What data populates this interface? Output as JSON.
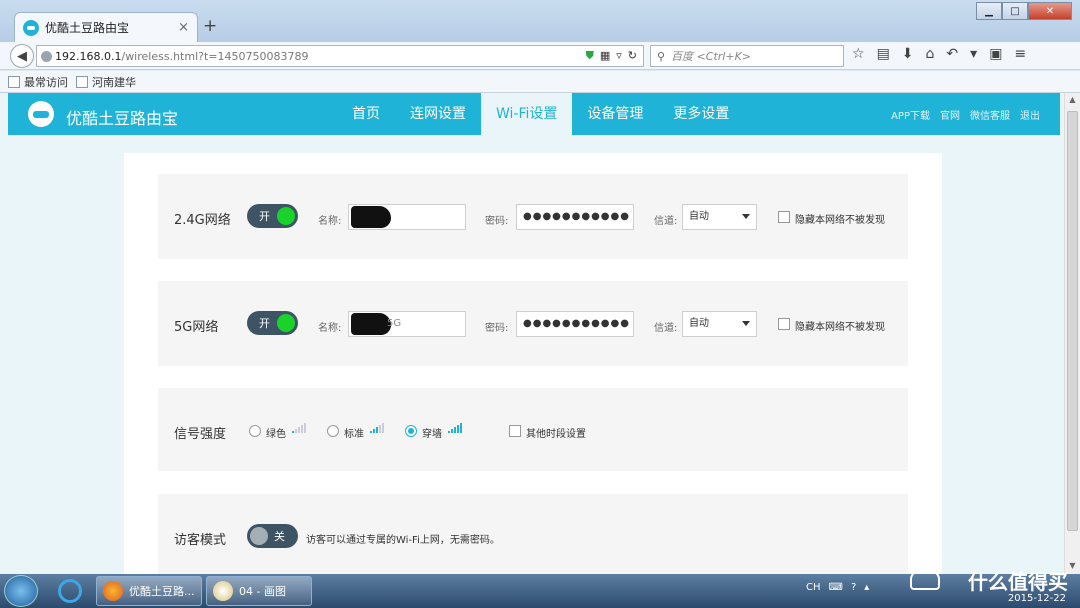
{
  "browser": {
    "tab_title": "优酷土豆路由宝",
    "tab_close": "×",
    "new_tab": "+",
    "url_host": "192.168.0.1",
    "url_path": "/wireless.html?t=1450750083789",
    "search_placeholder": "百度 <Ctrl+K>",
    "bookmarks": [
      "最常访问",
      "河南建华"
    ]
  },
  "app": {
    "brand": "优酷土豆路由宝",
    "nav": [
      "首页",
      "连网设置",
      "Wi-Fi设置",
      "设备管理",
      "更多设置"
    ],
    "active_nav": "Wi-Fi设置",
    "top_links": [
      "APP下载",
      "官网",
      "微信客服",
      "退出"
    ]
  },
  "wifi": {
    "band24": {
      "label": "2.4G网络",
      "toggle": "开",
      "name_label": "名称:",
      "name_suffix": "",
      "pwd_label": "密码:",
      "pwd_value": "●●●●●●●●●●●",
      "channel_label": "信道:",
      "channel_value": "自动",
      "hide_label": "隐藏本网络不被发现"
    },
    "band5": {
      "label": "5G网络",
      "toggle": "开",
      "name_label": "名称:",
      "name_suffix": "5G",
      "pwd_label": "密码:",
      "pwd_value": "●●●●●●●●●●●",
      "channel_label": "信道:",
      "channel_value": "自动",
      "hide_label": "隐藏本网络不被发现"
    },
    "signal": {
      "label": "信号强度",
      "options": [
        "绿色",
        "标准",
        "穿墙"
      ],
      "selected": "穿墙",
      "schedule_label": "其他时段设置"
    },
    "guest": {
      "label": "访客模式",
      "toggle": "关",
      "desc": "访客可以通过专属的Wi-Fi上网，无需密码。"
    }
  },
  "taskbar": {
    "tasks": [
      "优酷土豆路...",
      "04 - 画图"
    ],
    "tray_lang": "CH",
    "clock_date": "2015-12-22",
    "watermark": "什么值得买"
  },
  "colors": {
    "accent": "#1fb3d8",
    "toggle_on": "#19d22a",
    "toggle_bg": "#3e5464"
  }
}
